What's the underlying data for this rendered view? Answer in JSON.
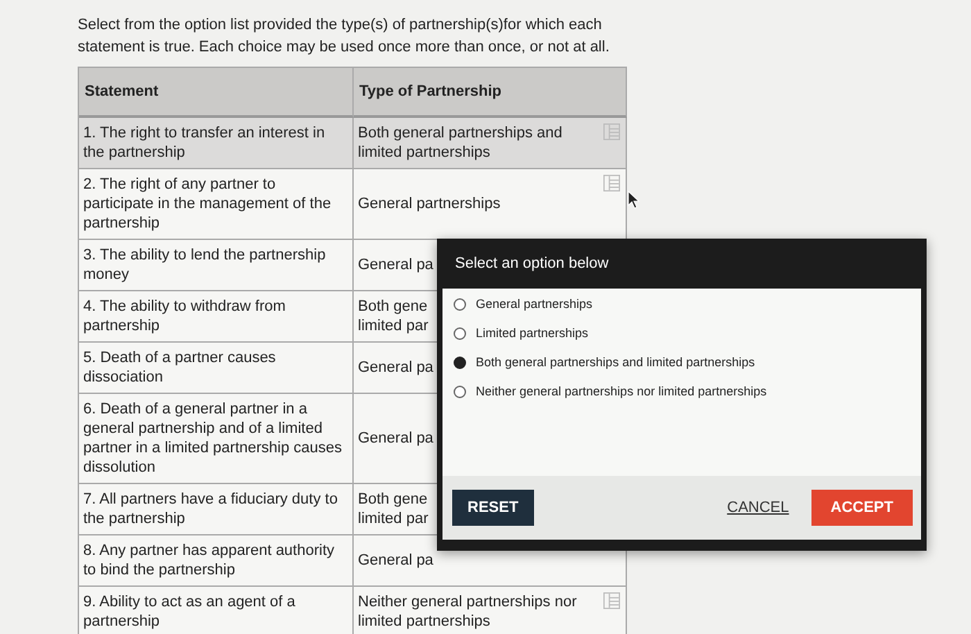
{
  "instructions": "Select from the option list provided the type(s) of partnership(s)for which each statement is true. Each choice may be used once more than once, or not at all.",
  "table": {
    "columns": [
      "Statement",
      "Type of Partnership"
    ],
    "rows": [
      {
        "statement": "1. The right to transfer an interest in the partnership",
        "type_lines": [
          "Both general partnerships and",
          "limited partnerships"
        ],
        "selected": true,
        "menu_icon": true
      },
      {
        "statement": "2. The right of any partner to participate in the management of the partnership",
        "type_lines": [
          "General partnerships"
        ],
        "selected": false,
        "menu_icon": true
      },
      {
        "statement": "3. The ability to lend the partnership money",
        "type_lines": [
          "General pa"
        ],
        "selected": false,
        "menu_icon": false
      },
      {
        "statement": "4. The ability to withdraw from partnership",
        "type_lines": [
          "Both gene",
          "limited par"
        ],
        "selected": false,
        "menu_icon": false
      },
      {
        "statement": "5. Death of a partner causes dissociation",
        "type_lines": [
          "General pa"
        ],
        "selected": false,
        "menu_icon": false
      },
      {
        "statement": "6. Death of a general partner in a general partnership and of a limited partner in a limited partnership causes dissolution",
        "type_lines": [
          "General pa"
        ],
        "selected": false,
        "menu_icon": false
      },
      {
        "statement": "7. All partners have a fiduciary duty to the partnership",
        "type_lines": [
          "Both gene",
          "limited par"
        ],
        "selected": false,
        "menu_icon": false
      },
      {
        "statement": "8. Any partner has apparent authority to bind the partnership",
        "type_lines": [
          "General pa"
        ],
        "selected": false,
        "menu_icon": false
      },
      {
        "statement": "9. Ability to act as an agent of a partnership",
        "type_lines": [
          "Neither general partnerships nor",
          "limited partnerships"
        ],
        "selected": false,
        "menu_icon": true
      }
    ]
  },
  "dialog": {
    "title": "Select an option below",
    "options": [
      {
        "label": "General partnerships",
        "selected": false
      },
      {
        "label": "Limited partnerships",
        "selected": false
      },
      {
        "label": "Both general partnerships and limited partnerships",
        "selected": true
      },
      {
        "label": "Neither general partnerships nor limited partnerships",
        "selected": false
      }
    ],
    "buttons": {
      "reset": "RESET",
      "cancel": "CANCEL",
      "accept": "ACCEPT"
    }
  }
}
